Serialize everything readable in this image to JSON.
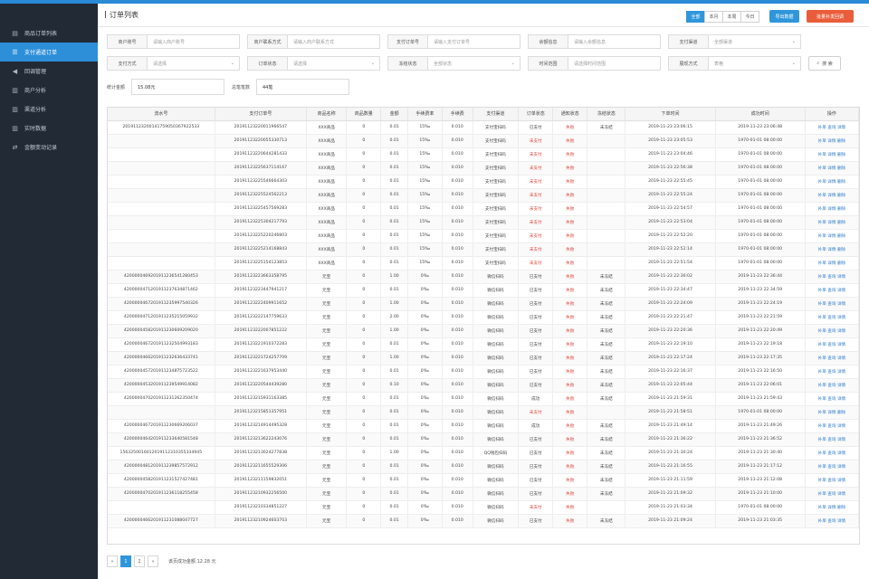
{
  "sidebar": {
    "items": [
      {
        "label": "商品订单列表",
        "icon": "grid-icon",
        "glyph": "▤",
        "active": false
      },
      {
        "label": "支付通道订单",
        "icon": "list-icon",
        "glyph": "☰",
        "active": true
      },
      {
        "label": "回调管理",
        "icon": "megaphone-icon",
        "glyph": "◀",
        "active": false
      },
      {
        "label": "商户分析",
        "icon": "bar-chart-icon",
        "glyph": "▥",
        "active": false
      },
      {
        "label": "渠道分析",
        "icon": "bar-chart-icon",
        "glyph": "▥",
        "active": false
      },
      {
        "label": "实时数据",
        "icon": "bar-chart-icon",
        "glyph": "▥",
        "active": false
      },
      {
        "label": "金额变动记录",
        "icon": "transfer-icon",
        "glyph": "⇄",
        "active": false
      }
    ]
  },
  "header": {
    "title": "订单列表",
    "ranges": [
      {
        "label": "全部",
        "active": true
      },
      {
        "label": "本月",
        "active": false
      },
      {
        "label": "本周",
        "active": false
      },
      {
        "label": "今日",
        "active": false
      }
    ],
    "export_label": "导出数据",
    "batch_label": "批量补发回调"
  },
  "filters": {
    "row1": [
      {
        "label": "商户账号",
        "placeholder": "请输入商户账号",
        "type": "input"
      },
      {
        "label": "商户联系方式",
        "placeholder": "请输入商户联系方式",
        "type": "input"
      },
      {
        "label": "支付订单号",
        "placeholder": "请输入支付订单号",
        "type": "input"
      },
      {
        "label": "余额信息",
        "placeholder": "请输入余额信息",
        "type": "input"
      },
      {
        "label": "支付渠道",
        "placeholder": "全部渠道",
        "type": "select"
      }
    ],
    "row2": [
      {
        "label": "支付方式",
        "placeholder": "请选择",
        "type": "select"
      },
      {
        "label": "订单状态",
        "placeholder": "请选择",
        "type": "select"
      },
      {
        "label": "冻结状态",
        "placeholder": "全部状态",
        "type": "select"
      },
      {
        "label": "时间范围",
        "placeholder": "请选择时间范围",
        "type": "input"
      },
      {
        "label": "展现方式",
        "placeholder": "表格",
        "type": "select"
      }
    ],
    "search_label": "搜 索"
  },
  "stats": [
    {
      "label": "统计金额",
      "value": "15.08元"
    },
    {
      "label": "总笔笔数",
      "value": "44笔"
    }
  ],
  "table": {
    "columns": [
      "流水号",
      "支付订单号",
      "商品名称",
      "商品数量",
      "金额",
      "手续费率",
      "手续费",
      "支付渠道",
      "订单状态",
      "通知状态",
      "冻结状态",
      "下单时间",
      "成功时间",
      "操作"
    ],
    "rows": [
      [
        "20191123200141759050367922533",
        "20191123220011966547",
        "XXX商品",
        "0",
        "0.01",
        "15‰",
        "0.010",
        "支付宝扫码",
        "已支付",
        "失败",
        "未冻结",
        "2019-11-23 23:06:15",
        "2019-11-23 23:06:48",
        "补单 查询 详情"
      ],
      [
        "",
        "20191123220055330713",
        "XXX商品",
        "0",
        "0.01",
        "15‰",
        "0.010",
        "支付宝扫码",
        "未支付",
        "失败",
        "",
        "2019-11-23 23:05:53",
        "1970-01-01 08:00:00",
        "补单 详情 删除"
      ],
      [
        "",
        "20191123220644281433",
        "XXX商品",
        "0",
        "0.01",
        "15‰",
        "0.010",
        "支付宝扫码",
        "未支付",
        "失败",
        "",
        "2019-11-23 23:04:46",
        "1970-01-01 08:00:00",
        "补单 详情 删除"
      ],
      [
        "",
        "20191123225637114167",
        "XXX商品",
        "0",
        "0.01",
        "15‰",
        "0.010",
        "支付宝扫码",
        "未支付",
        "失败",
        "",
        "2019-11-23 22:56:38",
        "1970-01-01 08:00:00",
        "补单 详情 删除"
      ],
      [
        "",
        "20191123225546664303",
        "XXX商品",
        "0",
        "0.01",
        "15‰",
        "0.010",
        "支付宝扫码",
        "未支付",
        "失败",
        "",
        "2019-11-23 22:55:45",
        "1970-01-01 08:00:00",
        "补单 详情 删除"
      ],
      [
        "",
        "20191123225524562213",
        "XXX商品",
        "0",
        "0.01",
        "15‰",
        "0.010",
        "支付宝扫码",
        "未支付",
        "失败",
        "",
        "2019-11-23 22:55:24",
        "1970-01-01 08:00:00",
        "补单 详情 删除"
      ],
      [
        "",
        "20191123225457569283",
        "XXX商品",
        "0",
        "0.01",
        "15‰",
        "0.010",
        "支付宝扫码",
        "未支付",
        "失败",
        "",
        "2019-11-23 22:54:57",
        "1970-01-01 08:00:00",
        "补单 详情 删除"
      ],
      [
        "",
        "20191123225304217793",
        "XXX商品",
        "0",
        "0.01",
        "15‰",
        "0.010",
        "支付宝扫码",
        "未支付",
        "失败",
        "",
        "2019-11-23 22:53:04",
        "1970-01-01 08:00:00",
        "补单 详情 删除"
      ],
      [
        "",
        "20191123225220246803",
        "XXX商品",
        "0",
        "0.01",
        "15‰",
        "0.010",
        "支付宝扫码",
        "未支付",
        "失败",
        "",
        "2019-11-23 22:52:20",
        "1970-01-01 08:00:00",
        "补单 详情 删除"
      ],
      [
        "",
        "20191123225214168843",
        "XXX商品",
        "0",
        "0.01",
        "15‰",
        "0.010",
        "支付宝扫码",
        "未支付",
        "失败",
        "",
        "2019-11-23 22:52:14",
        "1970-01-01 08:00:00",
        "补单 详情 删除"
      ],
      [
        "",
        "20191123225154123853",
        "XXX商品",
        "0",
        "0.01",
        "15‰",
        "0.010",
        "支付宝扫码",
        "未支付",
        "失败",
        "",
        "2019-11-23 22:51:54",
        "1970-01-01 08:00:00",
        "补单 详情 删除"
      ],
      [
        "4200000469201911236541280453",
        "20191123223663358795",
        "元宝",
        "0",
        "1.00",
        "0‰",
        "0.010",
        "微信扫码",
        "已支付",
        "失败",
        "未冻结",
        "2019-11-23 22:36:02",
        "2019-11-23 22:36:44",
        "补单 查询 详情"
      ],
      [
        "4200000471201911237634871462",
        "20191123223447941217",
        "元宝",
        "0",
        "0.01",
        "0‰",
        "0.010",
        "微信扫码",
        "已支付",
        "失败",
        "未冻结",
        "2019-11-23 22:34:47",
        "2019-11-23 22:34:59",
        "补单 查询 详情"
      ],
      [
        "4200000467201911235997540326",
        "20191123222409911652",
        "元宝",
        "0",
        "1.00",
        "0‰",
        "0.010",
        "微信扫码",
        "已支付",
        "失败",
        "未冻结",
        "2019-11-23 22:24:09",
        "2019-11-23 22:24:19",
        "补单 查询 详情"
      ],
      [
        "4200000471201911235215059932",
        "20191123222147759633",
        "元宝",
        "0",
        "2.00",
        "0‰",
        "0.010",
        "微信扫码",
        "已支付",
        "失败",
        "未冻结",
        "2019-11-23 22:21:47",
        "2019-11-23 22:21:59",
        "补单 查询 详情"
      ],
      [
        "4200000458201911230609209020",
        "20191123222007851222",
        "元宝",
        "0",
        "1.00",
        "0‰",
        "0.010",
        "微信扫码",
        "已支付",
        "失败",
        "未冻结",
        "2019-11-23 22:20:36",
        "2019-11-23 22:20:49",
        "补单 查询 详情"
      ],
      [
        "4200000467201911232504993183",
        "20191123221910372283",
        "元宝",
        "0",
        "0.01",
        "0‰",
        "0.010",
        "微信扫码",
        "已支付",
        "失败",
        "未冻结",
        "2019-11-23 22:19:10",
        "2019-11-23 22:19:18",
        "补单 查询 详情"
      ],
      [
        "4200000466201911232636433741",
        "20191123221724257709",
        "元宝",
        "0",
        "1.00",
        "0‰",
        "0.010",
        "微信扫码",
        "已支付",
        "失败",
        "未冻结",
        "2019-11-23 22:17:24",
        "2019-11-23 22:17:35",
        "补单 查询 详情"
      ],
      [
        "4200000457201911234875723522",
        "20191123221637953440",
        "元宝",
        "0",
        "0.01",
        "0‰",
        "0.010",
        "微信扫码",
        "已支付",
        "失败",
        "未冻结",
        "2019-11-23 22:16:37",
        "2019-11-23 22:16:50",
        "补单 查询 详情"
      ],
      [
        "4200000453201911239549914082",
        "20191123220544439280",
        "元宝",
        "0",
        "0.10",
        "0‰",
        "0.010",
        "微信扫码",
        "已支付",
        "失败",
        "未冻结",
        "2019-11-23 22:05:44",
        "2019-11-23 22:06:01",
        "补单 查询 详情"
      ],
      [
        "4200000470201911231262350474",
        "20191123215931163385",
        "元宝",
        "0",
        "0.01",
        "0‰",
        "0.010",
        "微信扫码",
        "成功",
        "失败",
        "未冻结",
        "2019-11-23 21:59:31",
        "2019-11-23 21:59:43",
        "补单 查询 详情"
      ],
      [
        "",
        "20191123215851357951",
        "元宝",
        "0",
        "0.01",
        "0‰",
        "0.010",
        "微信扫码",
        "未支付",
        "失败",
        "",
        "2019-11-23 21:58:51",
        "1970-01-01 08:00:00",
        "补单 详情 删除"
      ],
      [
        "4200000467201911230669206037",
        "20191123214914495328",
        "元宝",
        "0",
        "0.01",
        "0‰",
        "0.010",
        "微信扫码",
        "成功",
        "失败",
        "未冻结",
        "2019-11-23 21:49:14",
        "2019-11-23 21:49:26",
        "补单 查询 详情"
      ],
      [
        "4200000464201911233640581548",
        "20191123213622243076",
        "元宝",
        "0",
        "0.01",
        "0‰",
        "0.010",
        "微信扫码",
        "已支付",
        "失败",
        "未冻结",
        "2019-11-23 21:36:22",
        "2019-11-23 21:36:52",
        "补单 查询 详情"
      ],
      [
        "1563250016012019112310355334945",
        "20191123213024277838",
        "元宝",
        "0",
        "1.00",
        "0‰",
        "0.010",
        "QQ钱包扫码",
        "已支付",
        "失败",
        "未冻结",
        "2019-11-23 21:30:24",
        "2019-11-23 21:30:40",
        "补单 查询 详情"
      ],
      [
        "4200000481201911239857572912",
        "20191123211655529306",
        "元宝",
        "0",
        "0.01",
        "0‰",
        "0.010",
        "微信扫码",
        "已支付",
        "失败",
        "未冻结",
        "2019-11-23 21:16:55",
        "2019-11-23 21:17:12",
        "补单 查询 详情"
      ],
      [
        "4200000458201911231527427481",
        "20191123211159832051",
        "元宝",
        "0",
        "0.01",
        "0‰",
        "0.010",
        "微信扫码",
        "已支付",
        "失败",
        "未冻结",
        "2019-11-23 21:11:59",
        "2019-11-23 21:12:08",
        "补单 查询 详情"
      ],
      [
        "4200000470201911236118255458",
        "20191123210932256500",
        "元宝",
        "0",
        "0.01",
        "0‰",
        "0.010",
        "微信扫码",
        "已支付",
        "失败",
        "未冻结",
        "2019-11-23 21:09:32",
        "2019-11-23 21:10:00",
        "补单 查询 详情"
      ],
      [
        "",
        "20191123210334851227",
        "元宝",
        "0",
        "0.01",
        "0‰",
        "0.010",
        "微信扫码",
        "未支付",
        "失败",
        "",
        "2019-11-23 21:03:34",
        "1970-01-01 08:00:00",
        "补单 详情 删除"
      ],
      [
        "4200000466201911231088047727",
        "20191123210924603703",
        "元宝",
        "0",
        "0.01",
        "0‰",
        "0.010",
        "微信扫码",
        "已支付",
        "失败",
        "未冻结",
        "2019-11-23 21:09:24",
        "2019-11-23 21:03:35",
        "补单 查询 详情"
      ]
    ]
  },
  "pager": {
    "prev": "«",
    "pages": [
      "1",
      "2"
    ],
    "current": "1",
    "next": "»",
    "info": "该页成功金额 12.28 元"
  }
}
